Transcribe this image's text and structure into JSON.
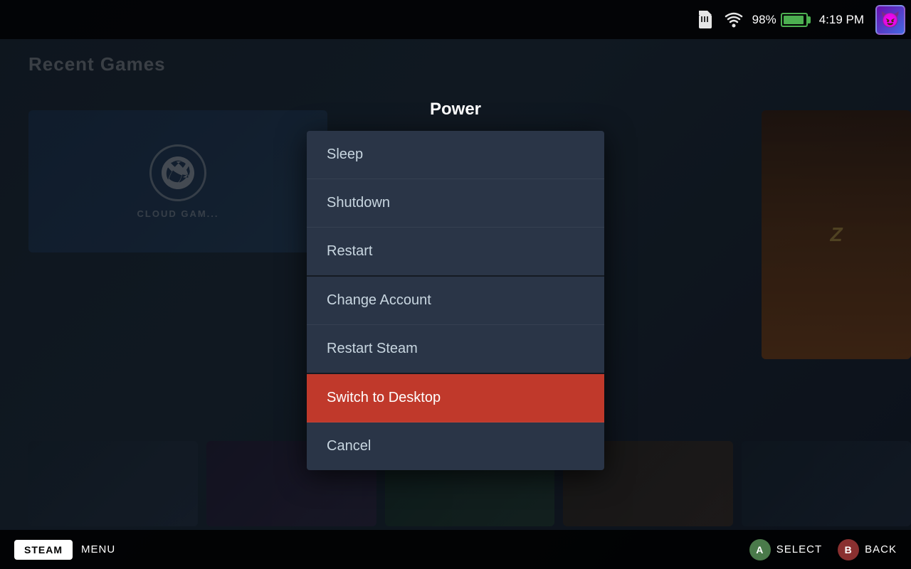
{
  "statusBar": {
    "batteryPercent": "98%",
    "time": "4:19 PM",
    "avatarEmoji": "😈"
  },
  "background": {
    "recentGamesLabel": "Recent Games",
    "cloudGamingLabel": "CLOUD GAM..."
  },
  "modal": {
    "title": "Power",
    "items": [
      {
        "id": "sleep",
        "label": "Sleep",
        "highlighted": false,
        "separator_after": false
      },
      {
        "id": "shutdown",
        "label": "Shutdown",
        "highlighted": false,
        "separator_after": false
      },
      {
        "id": "restart",
        "label": "Restart",
        "highlighted": false,
        "separator_after": true
      },
      {
        "id": "change-account",
        "label": "Change Account",
        "highlighted": false,
        "separator_after": false
      },
      {
        "id": "restart-steam",
        "label": "Restart Steam",
        "highlighted": false,
        "separator_after": true
      },
      {
        "id": "switch-to-desktop",
        "label": "Switch to Desktop",
        "highlighted": true,
        "separator_after": false
      },
      {
        "id": "cancel",
        "label": "Cancel",
        "highlighted": false,
        "separator_after": false
      }
    ]
  },
  "taskbar": {
    "steamLabel": "STEAM",
    "menuLabel": "MENU",
    "selectLabel": "SELECT",
    "backLabel": "BACK",
    "btnALabel": "A",
    "btnBLabel": "B"
  }
}
